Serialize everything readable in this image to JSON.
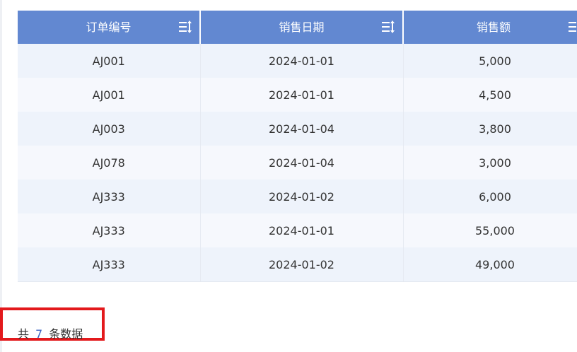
{
  "table": {
    "columns": [
      {
        "label": "订单编号",
        "sortable": true
      },
      {
        "label": "销售日期",
        "sortable": true
      },
      {
        "label": "销售额",
        "sortable": true
      }
    ],
    "rows": [
      {
        "order_no": "AJ001",
        "date": "2024-01-01",
        "amount": "5,000"
      },
      {
        "order_no": "AJ001",
        "date": "2024-01-01",
        "amount": "4,500"
      },
      {
        "order_no": "AJ003",
        "date": "2024-01-04",
        "amount": "3,800"
      },
      {
        "order_no": "AJ078",
        "date": "2024-01-04",
        "amount": "3,000"
      },
      {
        "order_no": "AJ333",
        "date": "2024-01-02",
        "amount": "6,000"
      },
      {
        "order_no": "AJ333",
        "date": "2024-01-01",
        "amount": "55,000"
      },
      {
        "order_no": "AJ333",
        "date": "2024-01-02",
        "amount": "49,000"
      }
    ]
  },
  "footer": {
    "prefix": "共",
    "count": "7",
    "suffix": "条数据"
  },
  "icons": {
    "sort": "sort-icon"
  },
  "colors": {
    "header_bg": "#6288d1",
    "row_odd": "#eef3fb",
    "row_even": "#f6f8fd",
    "count_accent": "#3d66c4",
    "highlight_border": "#e3191c"
  }
}
